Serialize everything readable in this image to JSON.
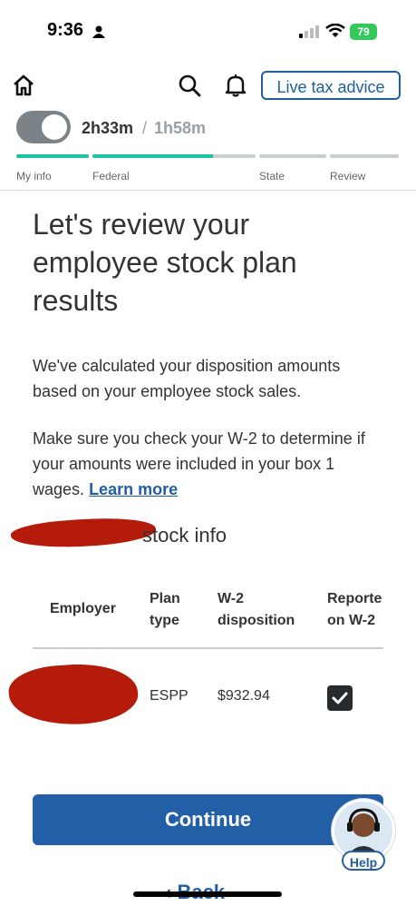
{
  "status_bar": {
    "time": "9:36",
    "battery": "79"
  },
  "header": {
    "live_tax_advice": "Live tax advice"
  },
  "timer": {
    "elapsed": "2h33m",
    "separator": "/",
    "estimate": "1h58m"
  },
  "progress": {
    "steps": [
      "My info",
      "Federal",
      "State",
      "Review"
    ],
    "accent_color": "#1cc3a2",
    "inactive_color": "#c9ced3"
  },
  "main": {
    "title": "Let's review your employee stock plan results",
    "para1": "We've calculated your disposition amounts based on your employee stock sales.",
    "para2": "Make sure you check your W-2 to determine if your amounts were included in your box 1 wages.",
    "learn_more": "Learn more",
    "section_title": "stock info"
  },
  "table": {
    "headers": {
      "employer": "Employer",
      "plan_type_1": "Plan",
      "plan_type_2": "type",
      "w2_1": "W-2",
      "w2_2": "disposition",
      "reported_1": "Reporte",
      "reported_2": "on W-2"
    },
    "row": {
      "plan_type": "ESPP",
      "disposition": "$932.94",
      "reported": true
    }
  },
  "footer": {
    "continue": "Continue",
    "help": "Help",
    "back": "Back"
  },
  "colors": {
    "primary": "#235fa6",
    "redaction": "#b51b0a"
  }
}
